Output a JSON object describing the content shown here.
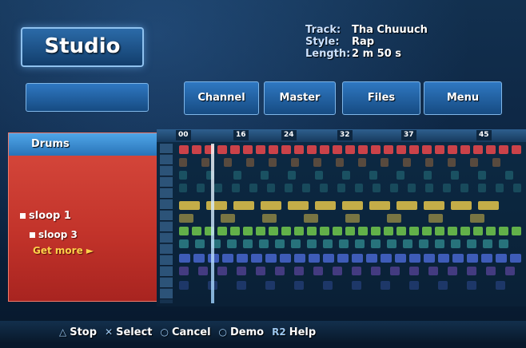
{
  "header": {
    "title": "Studio",
    "track_label": "Track:",
    "track_value": "Tha Chuuuch",
    "style_label": "Style:",
    "style_value": "Rap",
    "length_label": "Length:",
    "length_value": "2 m 50 s"
  },
  "tabs": {
    "blank_label": "",
    "channel": "Channel",
    "master": "Master",
    "files": "Files",
    "menu": "Menu"
  },
  "instrument_panel": {
    "header": "Drums",
    "loop_1": "sloop 1",
    "loop_3": "sloop 3",
    "get_more": "Get more ►"
  },
  "sequencer": {
    "ruler_ticks": [
      "00",
      "16",
      "24",
      "32",
      "37",
      "45"
    ]
  },
  "bottom_bar": {
    "stop": "Stop",
    "select": "Select",
    "cancel": "Cancel",
    "demo": "Demo",
    "r2": "R2",
    "help": "Help"
  },
  "colors": {
    "panel_red": "#c2332a",
    "tab_blue": "#2f78c2",
    "note_red": "#e0454a",
    "note_orange": "#e88a3a",
    "note_yellow": "#e5c64a",
    "note_green": "#6cc04a",
    "note_teal": "#3fb2b0",
    "note_blue": "#4b6ad8",
    "note_purple": "#8a5ad6"
  }
}
